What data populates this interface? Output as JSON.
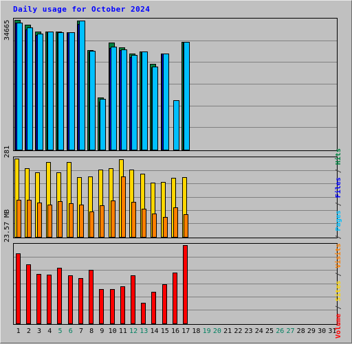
{
  "window": {
    "background_color": "#c0c0c0"
  },
  "title": {
    "text": "Daily usage for October 2024",
    "color": "#0000ff"
  },
  "legend": {
    "separator": " / ",
    "entries": [
      {
        "label": "Volume",
        "color": "#ff0000"
      },
      {
        "label": "Sites",
        "color": "#ffd700"
      },
      {
        "label": "Visits",
        "color": "#ff8000"
      },
      {
        "label": "Pages",
        "color": "#00c0ff"
      },
      {
        "label": "Files",
        "color": "#0000ff"
      },
      {
        "label": "Hits",
        "color": "#008040"
      }
    ]
  },
  "axis": {
    "days": [
      "1",
      "2",
      "3",
      "4",
      "5",
      "6",
      "7",
      "8",
      "9",
      "10",
      "11",
      "12",
      "13",
      "14",
      "15",
      "16",
      "17",
      "18",
      "19",
      "20",
      "21",
      "22",
      "23",
      "24",
      "25",
      "26",
      "27",
      "28",
      "29",
      "30",
      "31"
    ],
    "weekend_days": [
      "5",
      "6",
      "12",
      "13",
      "19",
      "20",
      "26",
      "27"
    ],
    "weekend_color": "#008060",
    "weekday_color": "#000000"
  },
  "chart_data": [
    {
      "type": "bar",
      "panel": "hits-files-pages",
      "title": "Daily usage for October 2024",
      "xlabel": "",
      "ylabel": "Hits / Files / Pages",
      "ymax_label": "34665",
      "ylim": [
        0,
        34665
      ],
      "gridlines": 5,
      "categories": [
        "1",
        "2",
        "3",
        "4",
        "5",
        "6",
        "7",
        "8",
        "9",
        "10",
        "11",
        "12",
        "13",
        "14",
        "15",
        "16",
        "17",
        "18",
        "19",
        "20",
        "21",
        "22",
        "23",
        "24",
        "25",
        "26",
        "27",
        "28",
        "29",
        "30",
        "31"
      ],
      "series": [
        {
          "name": "Hits",
          "color": "#008040",
          "values": [
            34665,
            33400,
            31600,
            31500,
            31600,
            31400,
            34450,
            26600,
            14000,
            28700,
            27300,
            25800,
            26300,
            23000,
            25800,
            0,
            28800,
            0,
            0,
            0,
            0,
            0,
            0,
            0,
            0,
            0,
            0,
            0,
            0,
            0,
            0
          ]
        },
        {
          "name": "Files",
          "color": "#0000ff",
          "values": [
            33900,
            32200,
            30600,
            31500,
            31300,
            31400,
            33500,
            26300,
            13000,
            27200,
            26600,
            24900,
            26100,
            22000,
            25800,
            0,
            28800,
            0,
            0,
            0,
            0,
            0,
            0,
            0,
            0,
            0,
            0,
            0,
            0,
            0,
            0
          ]
        },
        {
          "name": "Pages",
          "color": "#00c0ff",
          "values": [
            34000,
            32700,
            31000,
            31500,
            31400,
            31400,
            34450,
            26400,
            13700,
            27500,
            26800,
            25300,
            26200,
            22300,
            25800,
            13300,
            28800,
            0,
            0,
            0,
            0,
            0,
            0,
            0,
            0,
            0,
            0,
            0,
            0,
            0,
            0
          ]
        }
      ]
    },
    {
      "type": "bar",
      "panel": "sites-visits",
      "xlabel": "",
      "ylabel": "Sites / Visits",
      "ymax_label": "281",
      "ylim": [
        0,
        281
      ],
      "gridlines": 5,
      "categories": [
        "1",
        "2",
        "3",
        "4",
        "5",
        "6",
        "7",
        "8",
        "9",
        "10",
        "11",
        "12",
        "13",
        "14",
        "15",
        "16",
        "17",
        "18",
        "19",
        "20",
        "21",
        "22",
        "23",
        "24",
        "25",
        "26",
        "27",
        "28",
        "29",
        "30",
        "31"
      ],
      "series": [
        {
          "name": "Sites",
          "color": "#ffd700",
          "values": [
            281,
            248,
            233,
            270,
            232,
            269,
            215,
            218,
            242,
            247,
            278,
            243,
            227,
            195,
            199,
            212,
            215,
            0,
            0,
            0,
            0,
            0,
            0,
            0,
            0,
            0,
            0,
            0,
            0,
            0,
            0
          ]
        },
        {
          "name": "Visits",
          "color": "#ff8000",
          "values": [
            135,
            134,
            125,
            118,
            130,
            122,
            117,
            92,
            116,
            131,
            218,
            128,
            103,
            86,
            74,
            108,
            83,
            0,
            0,
            0,
            0,
            0,
            0,
            0,
            0,
            0,
            0,
            0,
            0,
            0,
            0
          ]
        }
      ]
    },
    {
      "type": "bar",
      "panel": "volume",
      "xlabel": "",
      "ylabel": "Volume (MB)",
      "ymax_label": "23.57 MB",
      "ylim": [
        0,
        23.57
      ],
      "gridlines": 5,
      "categories": [
        "1",
        "2",
        "3",
        "4",
        "5",
        "6",
        "7",
        "8",
        "9",
        "10",
        "11",
        "12",
        "13",
        "14",
        "15",
        "16",
        "17",
        "18",
        "19",
        "20",
        "21",
        "22",
        "23",
        "24",
        "25",
        "26",
        "27",
        "28",
        "29",
        "30",
        "31"
      ],
      "series": [
        {
          "name": "Volume",
          "color": "#ff0000",
          "values": [
            21.2,
            17.9,
            14.9,
            14.8,
            16.8,
            14.5,
            13.7,
            16.2,
            10.4,
            10.4,
            11.2,
            14.6,
            6.3,
            9.7,
            11.8,
            15.3,
            23.57,
            0,
            0,
            0,
            0,
            0,
            0,
            0,
            0,
            0,
            0,
            0,
            0,
            0,
            0
          ]
        }
      ]
    }
  ]
}
